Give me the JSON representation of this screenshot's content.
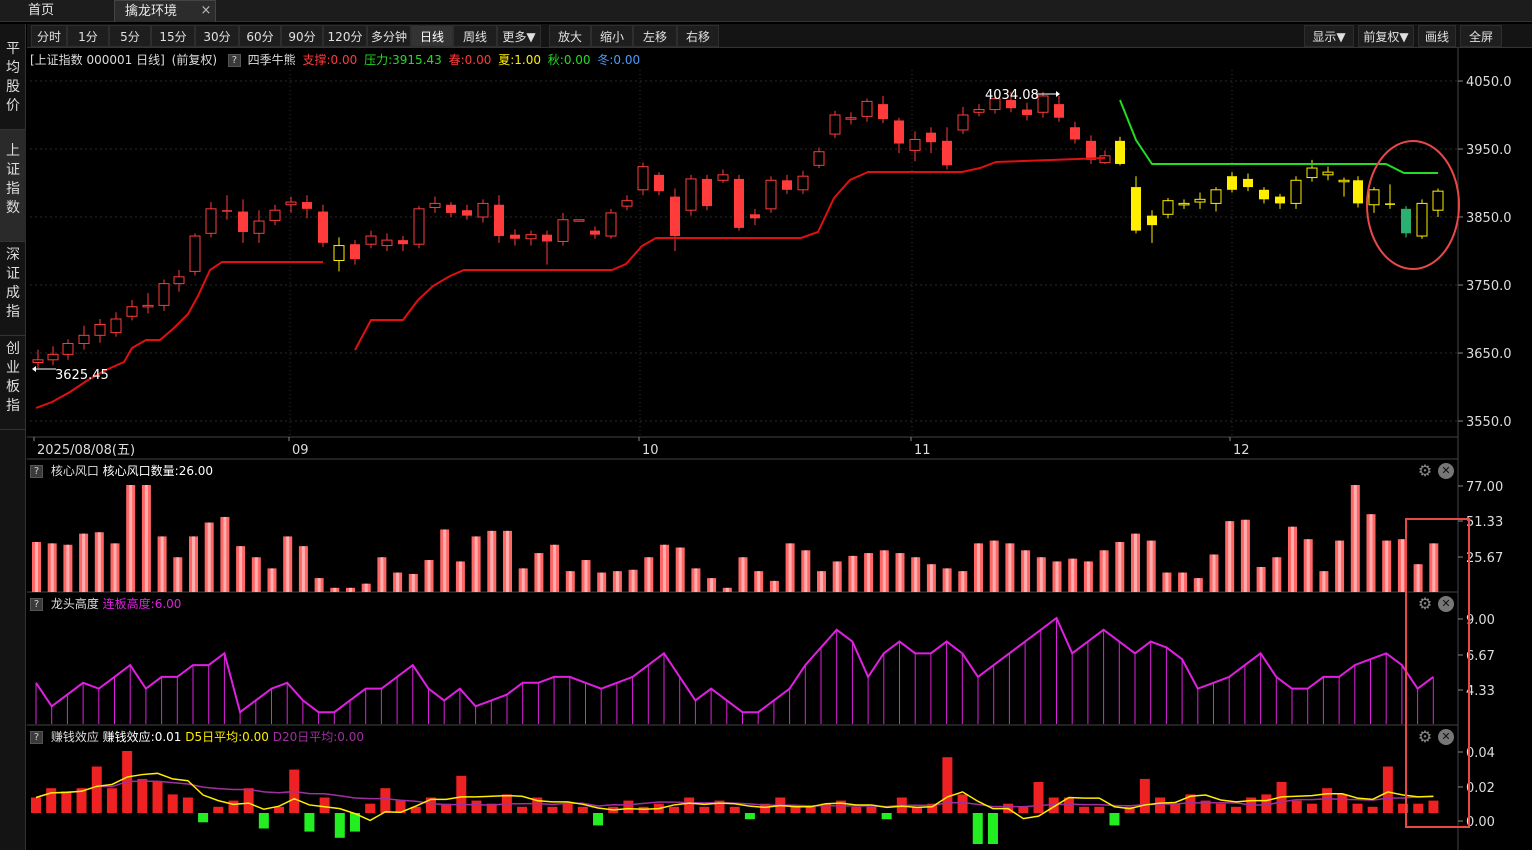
{
  "tabs": [
    {
      "label": "首页",
      "active": false
    },
    {
      "label": "擒龙环境",
      "active": true
    }
  ],
  "tab_close": "×",
  "toolbar": {
    "left": [
      "分时",
      "1分",
      "5分",
      "15分",
      "30分",
      "60分",
      "90分",
      "120分",
      "多分钟",
      "日线",
      "周线",
      "更多▼",
      "放大",
      "缩小",
      "左移",
      "右移"
    ],
    "active": "日线",
    "right": [
      "显示▼",
      "前复权▼",
      "画线",
      "全屏"
    ]
  },
  "sidenav": [
    {
      "label": "平均股价",
      "active": false
    },
    {
      "label": "上证指数",
      "active": true
    },
    {
      "label": "深证成指",
      "active": false
    },
    {
      "label": "创业板指",
      "active": false
    }
  ],
  "main_info": {
    "title": "[上证指数 000001 日线]",
    "adjust": "(前复权)",
    "qmark": "?",
    "indicator": "四季牛熊",
    "support": "支撑:0.00",
    "pressure": "压力:3915.43",
    "spring": "春:0.00",
    "summer": "夏:1.00",
    "autumn": "秋:0.00",
    "winter": "冬:0.00",
    "colors": {
      "support": "#ff3b3b",
      "pressure": "#22dd22",
      "spring": "#ff3b3b",
      "summer": "#ffee00",
      "autumn": "#22dd22",
      "winter": "#4a9cff"
    }
  },
  "price_axis": [
    "4050.0",
    "3950.0",
    "3850.0",
    "3750.0",
    "3650.0",
    "3550.0"
  ],
  "high_annotation": "4034.08",
  "low_annotation": "3625.45",
  "date_axis": [
    "2025/08/08(五)",
    "09",
    "10",
    "11",
    "12"
  ],
  "panes": {
    "core": {
      "qmark": "?",
      "name": "核心风口",
      "value": "核心风口数量:26.00",
      "axis": [
        "77.00",
        "51.33",
        "25.67"
      ],
      "value_color": "#ffffff"
    },
    "dragon": {
      "qmark": "?",
      "name": "龙头高度",
      "value": "连板高度:6.00",
      "axis": [
        "9.00",
        "6.67",
        "4.33"
      ],
      "value_color": "#e020e0"
    },
    "money": {
      "qmark": "?",
      "name": "赚钱效应",
      "value": "赚钱效应:0.01",
      "d5": "D5日平均:0.00",
      "d20": "D20日平均:0.00",
      "axis": [
        "0.04",
        "0.02",
        "0.00"
      ]
    }
  },
  "icons": {
    "gear": "gear-icon",
    "close": "close-circle-icon"
  }
}
